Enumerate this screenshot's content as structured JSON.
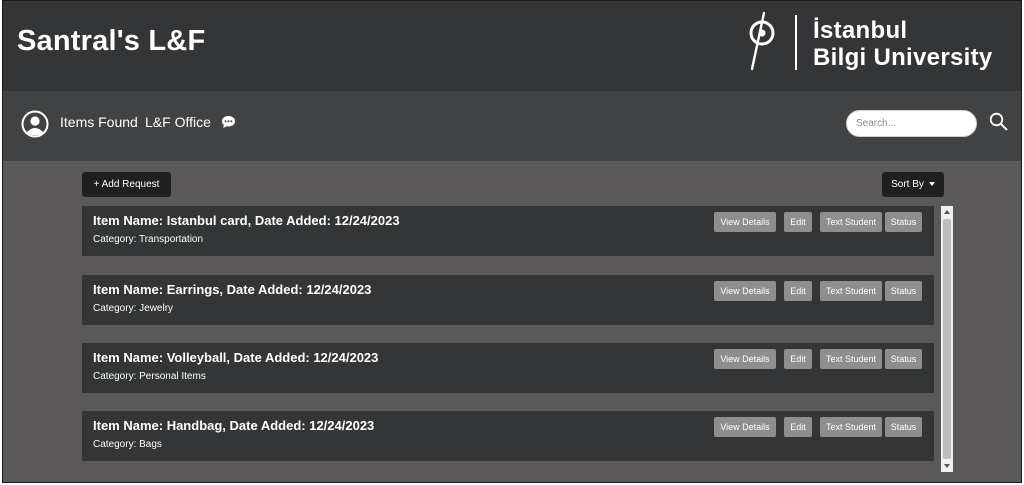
{
  "header": {
    "title": "Santral's L&F",
    "logo_line1": "İstanbul",
    "logo_line2": "Bilgi University"
  },
  "nav": {
    "items_found": "Items Found",
    "lf_office": "L&F Office",
    "search_placeholder": "Search..."
  },
  "toolbar": {
    "add_request": "+ Add Request",
    "sort_by": "Sort By"
  },
  "items": [
    {
      "title": "Item Name: Istanbul card, Date Added: 12/24/2023",
      "category": "Category: Transportation"
    },
    {
      "title": "Item Name: Earrings, Date Added: 12/24/2023",
      "category": "Category: Jewelry"
    },
    {
      "title": "Item Name: Volleyball, Date Added: 12/24/2023",
      "category": "Category: Personal Items"
    },
    {
      "title": "Item Name: Handbag, Date Added: 12/24/2023",
      "category": "Category: Bags"
    }
  ],
  "card_buttons": {
    "view_details": "View Details",
    "edit": "Edit",
    "text_student": "Text Student",
    "status": "Status"
  },
  "colors": {
    "header_bg": "#333536",
    "nav_bg": "#404243",
    "content_bg": "#5b595a",
    "card_bg": "#333536",
    "card_button_bg": "#8e8e8e"
  }
}
